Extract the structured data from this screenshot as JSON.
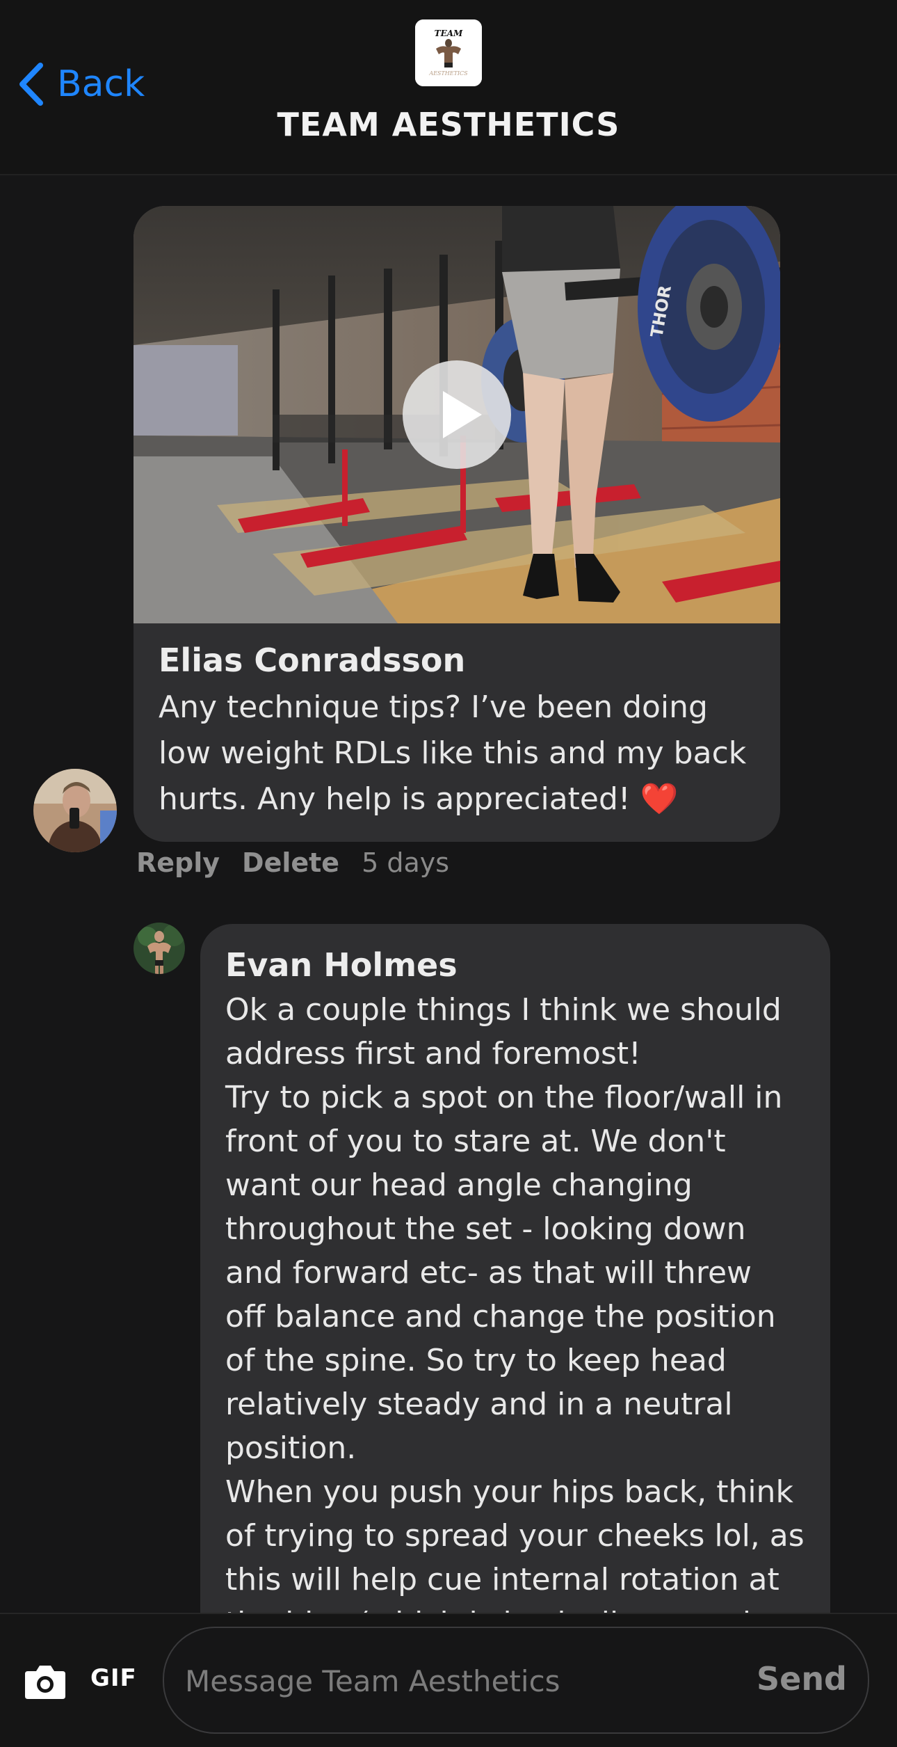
{
  "header": {
    "back_label": "Back",
    "title": "TEAM AESTHETICS",
    "logo_text_top": "TEAM",
    "logo_text_bottom": "AESTHETICS"
  },
  "post": {
    "author": "Elias Conradsson",
    "text": "Any technique tips? I’ve been doing\nlow weight RDLs like this and my back\nhurts. Any help is appreciated! ",
    "emoji": "❤️",
    "actions": {
      "reply": "Reply",
      "delete": "Delete"
    },
    "time": "5 days",
    "plate_text": "THOR"
  },
  "reply": {
    "author": "Evan Holmes",
    "text": "Ok a couple things I think we should\naddress first and foremost!\nTry to pick a spot on the floor/wall in\nfront of you to stare at. We don't\nwant our head angle changing\nthroughout the set - looking down\nand forward etc- as that will threw\noff balance and change the position\nof the spine. So try to keep head\nrelatively steady and in a neutral\nposition.\nWhen you push your hips back, think\nof trying to spread your cheeks lol, as\nthis will help cue internal rotation at\nthe hips (which is basically a good"
  },
  "composer": {
    "gif_label": "GIF",
    "placeholder": "Message Team Aesthetics",
    "send_label": "Send"
  },
  "colors": {
    "accent_blue": "#1f86ff",
    "bubble": "#2f2f31",
    "background": "#161617",
    "heart": "#e0192a"
  }
}
